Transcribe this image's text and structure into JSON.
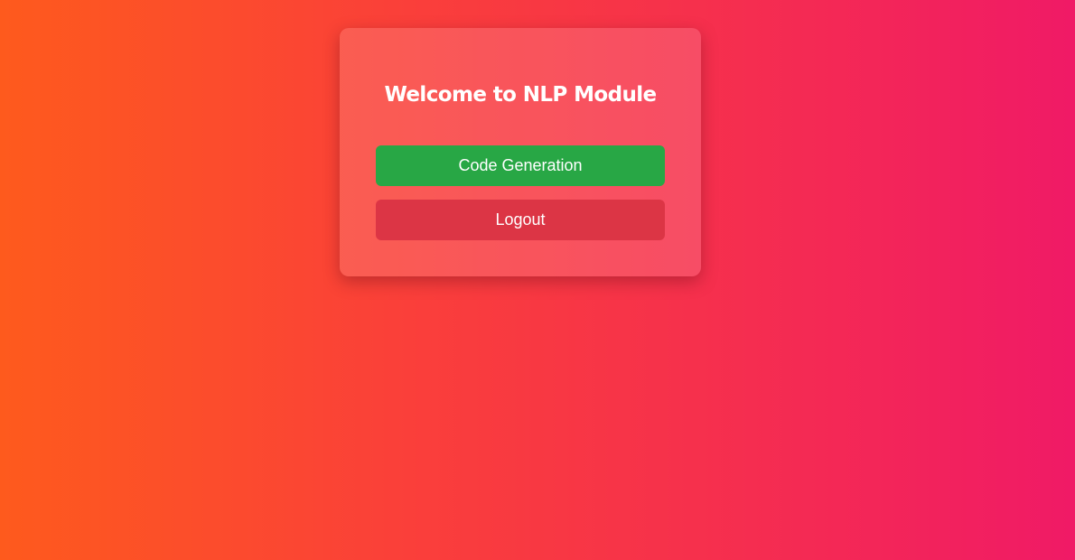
{
  "card": {
    "title": "Welcome to NLP Module",
    "buttons": {
      "code_generation_label": "Code Generation",
      "logout_label": "Logout"
    }
  },
  "colors": {
    "background_gradient": [
      "#fe5a1d",
      "#fa3f3a",
      "#f52d50",
      "#f01a66"
    ],
    "primary_button": "#28a745",
    "danger_button": "#dc3545",
    "text": "#ffffff"
  }
}
